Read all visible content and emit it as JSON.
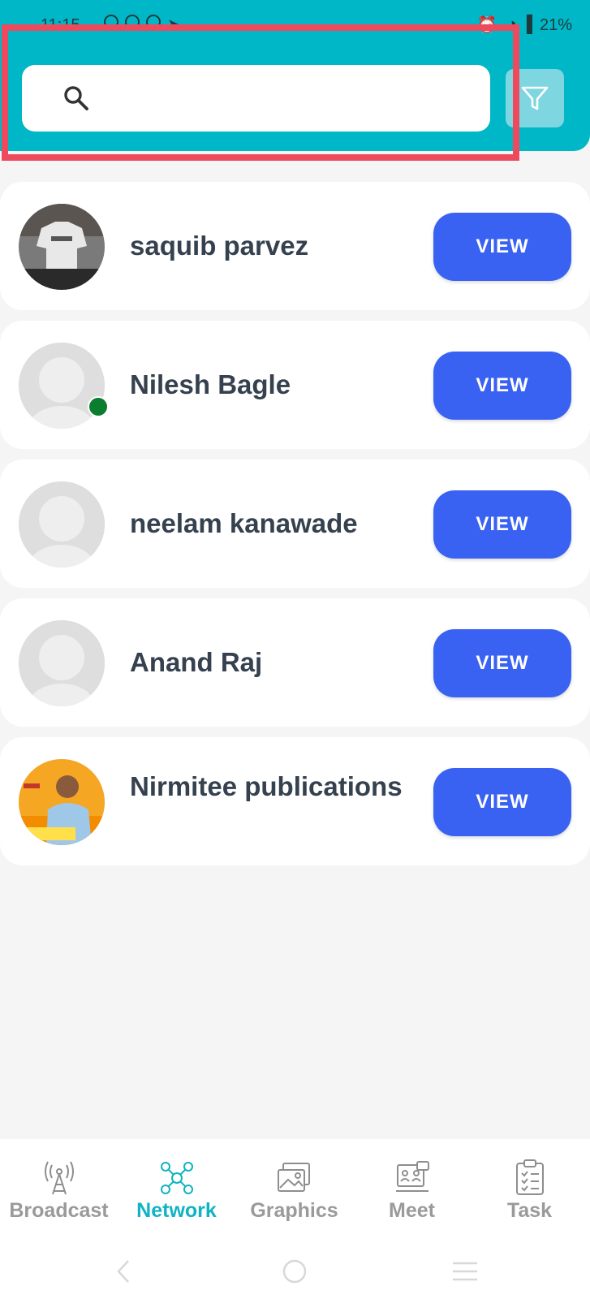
{
  "status_bar": {
    "time": "11:15",
    "battery": "21%"
  },
  "search": {
    "placeholder": "",
    "value": ""
  },
  "icons": {
    "search": "search-icon",
    "filter": "filter-icon"
  },
  "contacts": [
    {
      "name": "saquib parvez",
      "avatar": "photo",
      "online": false,
      "button": "VIEW"
    },
    {
      "name": "Nilesh Bagle",
      "avatar": "placeholder",
      "online": true,
      "button": "VIEW"
    },
    {
      "name": "neelam kanawade",
      "avatar": "placeholder",
      "online": false,
      "button": "VIEW"
    },
    {
      "name": "Anand Raj",
      "avatar": "placeholder",
      "online": false,
      "button": "VIEW"
    },
    {
      "name": "Nirmitee publications",
      "avatar": "photo",
      "online": false,
      "button": "VIEW"
    }
  ],
  "bottom_nav": [
    {
      "label": "Broadcast",
      "icon": "broadcast-tower-icon",
      "active": false
    },
    {
      "label": "Network",
      "icon": "network-icon",
      "active": true
    },
    {
      "label": "Graphics",
      "icon": "image-gallery-icon",
      "active": false
    },
    {
      "label": "Meet",
      "icon": "meeting-icon",
      "active": false
    },
    {
      "label": "Task",
      "icon": "clipboard-checklist-icon",
      "active": false
    }
  ],
  "colors": {
    "header": "#00b7c7",
    "view_button": "#3a62f2",
    "active_tab": "#10b3c3",
    "highlight": "#ee4a5d",
    "online": "#0a7d2e"
  }
}
